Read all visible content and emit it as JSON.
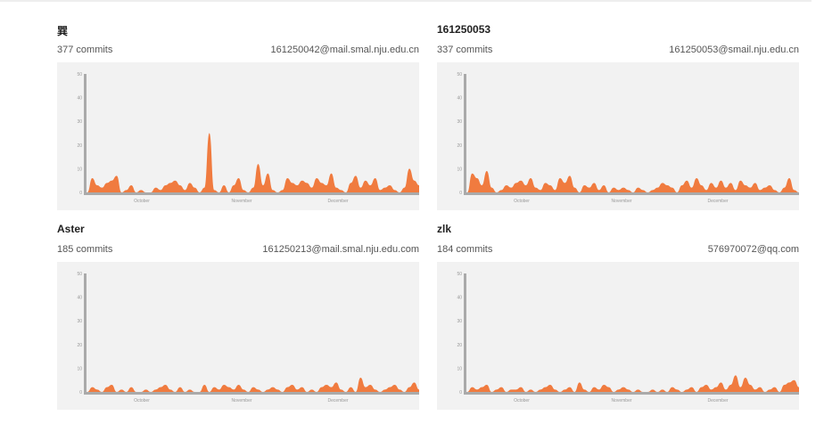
{
  "contributors": [
    {
      "name": "巽",
      "commits": "377 commits",
      "email": "161250042@mail.smal.nju.edu.cn",
      "chart_data": {
        "type": "area",
        "y_ticks": [
          "50",
          "40",
          "30",
          "20",
          "10",
          "0"
        ],
        "ylim": [
          0,
          50
        ],
        "x_month_labels": [
          "October",
          "November",
          "December"
        ],
        "values": [
          0,
          6,
          3,
          2,
          4,
          5,
          7,
          0,
          1,
          3,
          0,
          1,
          0,
          0,
          2,
          1,
          3,
          4,
          5,
          3,
          1,
          4,
          2,
          0,
          2,
          25,
          1,
          0,
          3,
          0,
          3,
          6,
          1,
          0,
          2,
          12,
          3,
          8,
          1,
          0,
          1,
          6,
          4,
          3,
          5,
          4,
          2,
          6,
          4,
          3,
          8,
          2,
          1,
          0,
          4,
          7,
          2,
          5,
          3,
          6,
          1,
          2,
          3,
          1,
          0,
          2,
          10,
          5,
          3
        ]
      }
    },
    {
      "name": "161250053",
      "commits": "337 commits",
      "email": "161250053@smail.nju.edu.cn",
      "chart_data": {
        "type": "area",
        "y_ticks": [
          "50",
          "40",
          "30",
          "20",
          "10",
          "0"
        ],
        "ylim": [
          0,
          50
        ],
        "x_month_labels": [
          "October",
          "November",
          "December"
        ],
        "values": [
          0,
          8,
          6,
          3,
          9,
          2,
          0,
          1,
          3,
          2,
          4,
          5,
          3,
          6,
          2,
          1,
          4,
          3,
          1,
          6,
          4,
          7,
          2,
          0,
          3,
          2,
          4,
          1,
          3,
          0,
          2,
          1,
          2,
          1,
          0,
          2,
          1,
          0,
          1,
          2,
          4,
          3,
          2,
          0,
          3,
          5,
          2,
          6,
          3,
          1,
          4,
          2,
          5,
          2,
          4,
          1,
          5,
          3,
          2,
          4,
          1,
          2,
          3,
          1,
          0,
          2,
          6,
          1,
          0
        ]
      }
    },
    {
      "name": "Aster",
      "commits": "185 commits",
      "email": "161250213@mail.smal.nju.edu.com",
      "chart_data": {
        "type": "area",
        "y_ticks": [
          "50",
          "40",
          "30",
          "20",
          "10",
          "0"
        ],
        "ylim": [
          0,
          50
        ],
        "x_month_labels": [
          "October",
          "November",
          "December"
        ],
        "values": [
          0,
          2,
          1,
          0,
          2,
          3,
          0,
          1,
          0,
          2,
          0,
          0,
          1,
          0,
          1,
          2,
          3,
          1,
          0,
          2,
          0,
          1,
          0,
          0,
          3,
          0,
          2,
          1,
          3,
          2,
          1,
          3,
          1,
          0,
          2,
          1,
          0,
          1,
          2,
          1,
          0,
          2,
          3,
          1,
          2,
          0,
          1,
          0,
          2,
          3,
          2,
          4,
          1,
          0,
          2,
          0,
          6,
          2,
          3,
          1,
          0,
          1,
          2,
          3,
          1,
          0,
          2,
          4,
          1
        ]
      }
    },
    {
      "name": "zlk",
      "commits": "184 commits",
      "email": "576970072@qq.com",
      "chart_data": {
        "type": "area",
        "y_ticks": [
          "50",
          "40",
          "30",
          "20",
          "10",
          "0"
        ],
        "ylim": [
          0,
          50
        ],
        "x_month_labels": [
          "October",
          "November",
          "December"
        ],
        "values": [
          0,
          2,
          1,
          2,
          3,
          0,
          1,
          2,
          0,
          1,
          1,
          2,
          0,
          1,
          0,
          1,
          2,
          3,
          1,
          0,
          1,
          2,
          0,
          4,
          1,
          0,
          2,
          1,
          3,
          2,
          0,
          1,
          2,
          1,
          0,
          1,
          0,
          0,
          1,
          0,
          1,
          0,
          2,
          1,
          0,
          1,
          2,
          0,
          2,
          3,
          1,
          2,
          4,
          1,
          3,
          7,
          2,
          6,
          3,
          1,
          2,
          0,
          1,
          2,
          0,
          3,
          4,
          5,
          2
        ]
      }
    }
  ],
  "colors": {
    "area": "#f07b3f",
    "axis": "#aaaaaa",
    "chart_bg": "#f2f2f2",
    "tick_text": "#999999"
  }
}
